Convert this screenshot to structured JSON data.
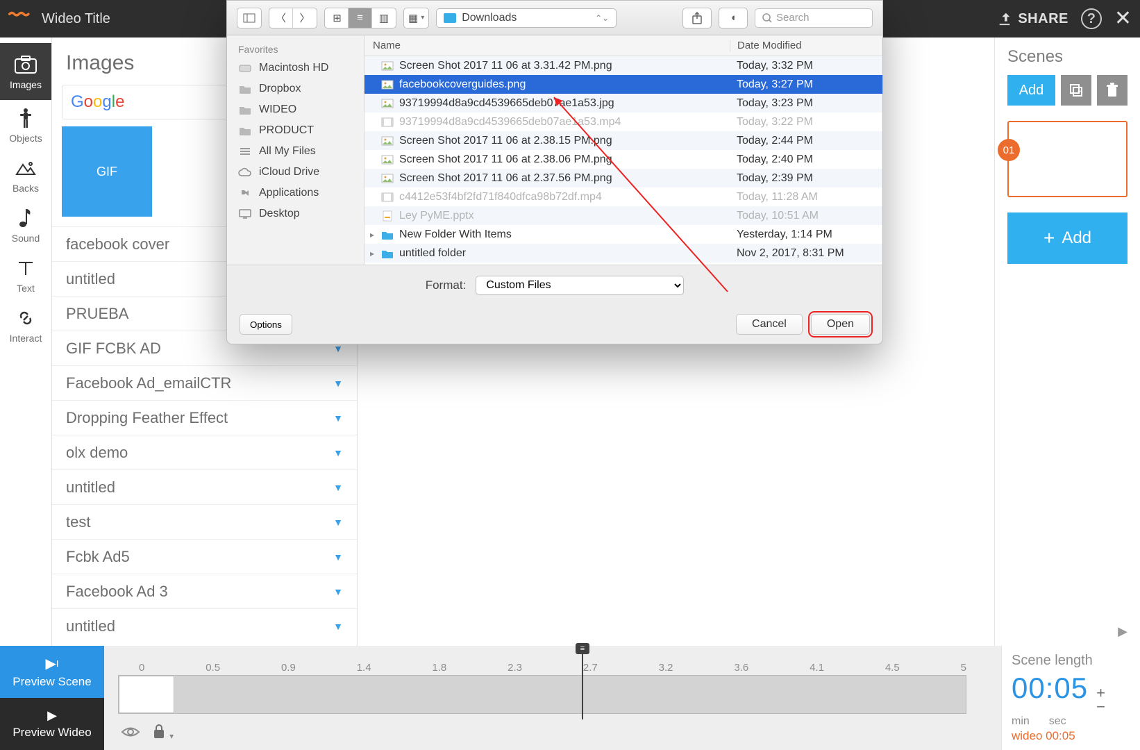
{
  "topbar": {
    "title": "Wideo Title",
    "share": "SHARE"
  },
  "vtoolbar": [
    {
      "label": "Images",
      "active": true
    },
    {
      "label": "Objects"
    },
    {
      "label": "Backs"
    },
    {
      "label": "Sound"
    },
    {
      "label": "Text"
    },
    {
      "label": "Interact"
    }
  ],
  "images_panel": {
    "title": "Images",
    "gif_tile": "GIF",
    "list": [
      "facebook cover",
      "untitled",
      "PRUEBA",
      "GIF FCBK AD",
      "Facebook Ad_emailCTR",
      "Dropping Feather Effect",
      "olx demo",
      "untitled",
      "test",
      "Fcbk Ad5",
      "Facebook Ad 3",
      "untitled"
    ]
  },
  "scenes": {
    "title": "Scenes",
    "add": "Add",
    "scene_num": "01",
    "big_add": "Add"
  },
  "bottom": {
    "preview_scene": "Preview Scene",
    "preview_wideo": "Preview Wideo",
    "ruler": [
      "0",
      "0.5",
      "0.9",
      "1.4",
      "1.8",
      "2.3",
      "2.7",
      "3.2",
      "3.6",
      "4.1",
      "4.5",
      "5"
    ],
    "scene_length_label": "Scene length",
    "scene_length_value": "00:05",
    "min_label": "min",
    "sec_label": "sec",
    "wideo_len": "wideo 00:05"
  },
  "mac": {
    "location": "Downloads",
    "search_placeholder": "Search",
    "sidebar_header": "Favorites",
    "sidebar": [
      {
        "label": "Macintosh HD",
        "icon": "disk"
      },
      {
        "label": "Dropbox",
        "icon": "folder"
      },
      {
        "label": "WIDEO",
        "icon": "folder"
      },
      {
        "label": "PRODUCT",
        "icon": "folder"
      },
      {
        "label": "All My Files",
        "icon": "stack"
      },
      {
        "label": "iCloud Drive",
        "icon": "cloud"
      },
      {
        "label": "Applications",
        "icon": "apps"
      },
      {
        "label": "Desktop",
        "icon": "desktop"
      }
    ],
    "columns": {
      "name": "Name",
      "date": "Date Modified"
    },
    "files": [
      {
        "name": "Screen Shot 2017 11 06 at 3.31.42 PM.png",
        "date": "Today, 3:32 PM",
        "kind": "img",
        "selected": false,
        "dim": false,
        "alt": true
      },
      {
        "name": "facebookcoverguides.png",
        "date": "Today, 3:27 PM",
        "kind": "img",
        "selected": true,
        "dim": false,
        "alt": false
      },
      {
        "name": "93719994d8a9cd4539665deb07ae1a53.jpg",
        "date": "Today, 3:23 PM",
        "kind": "img",
        "selected": false,
        "dim": false,
        "alt": true
      },
      {
        "name": "93719994d8a9cd4539665deb07ae1a53.mp4",
        "date": "Today, 3:22 PM",
        "kind": "mov",
        "selected": false,
        "dim": true,
        "alt": false
      },
      {
        "name": "Screen Shot 2017 11 06 at 2.38.15 PM.png",
        "date": "Today, 2:44 PM",
        "kind": "img",
        "selected": false,
        "dim": false,
        "alt": true
      },
      {
        "name": "Screen Shot 2017 11 06 at 2.38.06 PM.png",
        "date": "Today, 2:40 PM",
        "kind": "img",
        "selected": false,
        "dim": false,
        "alt": false
      },
      {
        "name": "Screen Shot 2017 11 06 at 2.37.56 PM.png",
        "date": "Today, 2:39 PM",
        "kind": "img",
        "selected": false,
        "dim": false,
        "alt": true
      },
      {
        "name": "c4412e53f4bf2fd71f840dfca98b72df.mp4",
        "date": "Today, 11:28 AM",
        "kind": "mov",
        "selected": false,
        "dim": true,
        "alt": false
      },
      {
        "name": "Ley PyME.pptx",
        "date": "Today, 10:51 AM",
        "kind": "doc",
        "selected": false,
        "dim": true,
        "alt": true
      },
      {
        "name": "New Folder With Items",
        "date": "Yesterday, 1:14 PM",
        "kind": "folder",
        "selected": false,
        "dim": false,
        "alt": false,
        "expand": true
      },
      {
        "name": "untitled folder",
        "date": "Nov 2, 2017, 8:31 PM",
        "kind": "folder",
        "selected": false,
        "dim": false,
        "alt": true,
        "expand": true
      }
    ],
    "format_label": "Format:",
    "format_value": "Custom Files",
    "options": "Options",
    "cancel": "Cancel",
    "open": "Open"
  }
}
